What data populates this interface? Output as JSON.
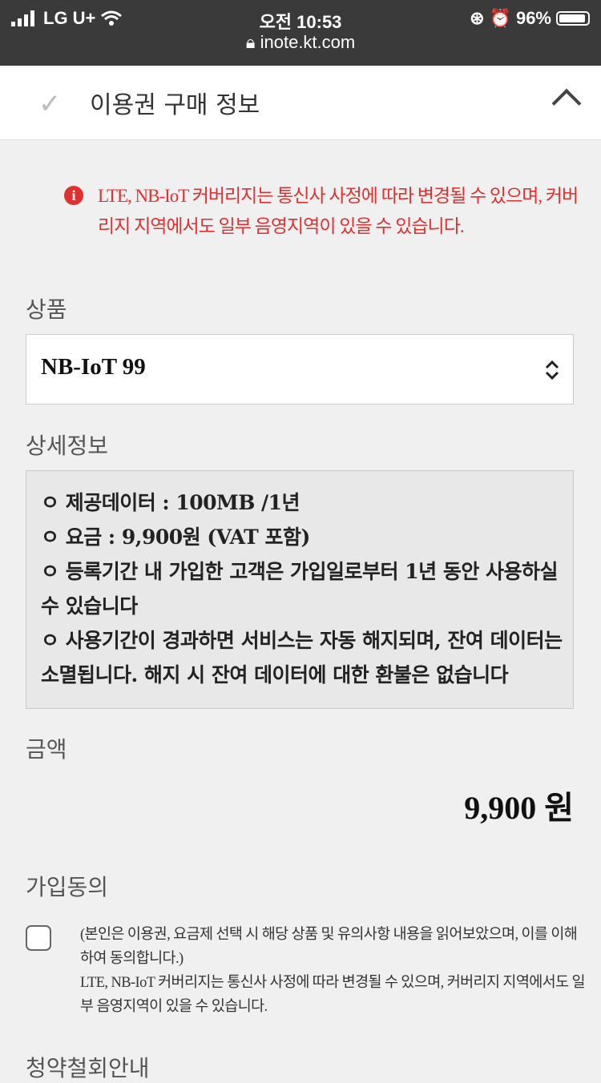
{
  "status_bar": {
    "carrier": "LG U+",
    "time": "오전 10:53",
    "battery": "96%",
    "battery_level": 0.96,
    "url": "inote.kt.com"
  },
  "header": {
    "title": "이용권 구매 정보"
  },
  "notice": {
    "text": "LTE, NB-IoT 커버리지는 통신사 사정에 따라 변경될 수 있으며, 커버리지 지역에서도 일부 음영지역이 있을 수 있습니다."
  },
  "product": {
    "label": "상품",
    "selected": "NB-IoT 99"
  },
  "details": {
    "label": "상세정보",
    "lines": [
      "ㅇ 제공데이터 : 100MB /1년",
      "ㅇ 요금 : 9,900원 (VAT 포함)",
      "ㅇ 등록기간 내 가입한 고객은 가입일로부터 1년 동안 사용하실 수 있습니다",
      "ㅇ 사용기간이 경과하면 서비스는 자동 해지되며, 잔여 데이터는 소멸됩니다. 해지 시 잔여 데이터에 대한 환불은 없습니다"
    ]
  },
  "price": {
    "label": "금액",
    "amount": "9,900 원"
  },
  "consent": {
    "label": "가입동의",
    "text_1": "(본인은 이용권, 요금제 선택 시 해당 상품 및 유의사항 내용을 읽어보았으며, 이를 이해하여 동의합니다.)",
    "text_2": "LTE, NB-IoT 커버리지는 통신사 사정에 따라 변경될 수 있으며, 커버리지 지역에서도 일부 음영지역이 있을 수 있습니다.",
    "checked": false
  },
  "next_section": {
    "label": "청약철회안내"
  }
}
